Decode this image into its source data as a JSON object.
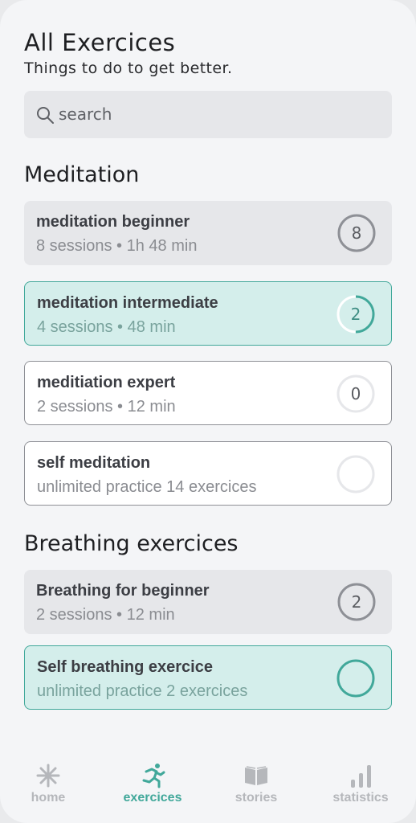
{
  "header": {
    "title": "All Exercices",
    "subtitle": "Things to do to get better."
  },
  "search": {
    "placeholder": "search",
    "icon": "search-icon"
  },
  "sections": [
    {
      "title": "Meditation",
      "items": [
        {
          "name": "meditation beginner",
          "meta": "8 sessions • 1h 48 min",
          "count": "8",
          "progress": 1.0,
          "style": "grey"
        },
        {
          "name": "meditation intermediate",
          "meta": "4 sessions • 48 min",
          "count": "2",
          "progress": 0.5,
          "style": "teal"
        },
        {
          "name": "meditiation expert",
          "meta": "2 sessions • 12 min",
          "count": "0",
          "progress": 0.0,
          "style": "white"
        },
        {
          "name": "self meditation",
          "meta": "unlimited practice 14 exercices",
          "count": "",
          "progress": 0.0,
          "style": "white"
        }
      ]
    },
    {
      "title": "Breathing exercices",
      "items": [
        {
          "name": "Breathing for beginner",
          "meta": "2 sessions • 12 min",
          "count": "2",
          "progress": 1.0,
          "style": "grey"
        },
        {
          "name": "Self breathing exercice",
          "meta": "unlimited practice 2 exercices",
          "count": "",
          "progress": 1.0,
          "style": "teal"
        }
      ]
    }
  ],
  "nav": [
    {
      "label": "home",
      "icon": "asterisk-icon",
      "active": false
    },
    {
      "label": "exercices",
      "icon": "running-icon",
      "active": true
    },
    {
      "label": "stories",
      "icon": "book-icon",
      "active": false
    },
    {
      "label": "statistics",
      "icon": "bar-chart-icon",
      "active": false
    }
  ],
  "colors": {
    "accent": "#41a89a",
    "ring_grey": "#8e9096",
    "ring_light": "#e6e7ea",
    "nav_inactive": "#b5b7bb"
  }
}
